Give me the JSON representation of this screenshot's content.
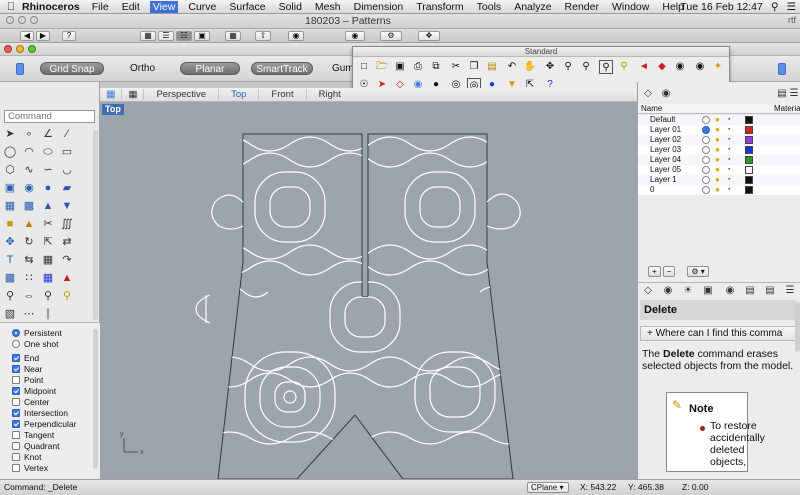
{
  "menubar": {
    "app": "Rhinoceros",
    "items": [
      "File",
      "Edit",
      "View",
      "Curve",
      "Surface",
      "Solid",
      "Mesh",
      "Dimension",
      "Transform",
      "Tools",
      "Analyze",
      "Render",
      "Window",
      "Help"
    ],
    "active_item": "View",
    "clock": "Tue 16 Feb  12:47"
  },
  "back_window": {
    "title": "180203 – Patterns",
    "right_text": "rtf"
  },
  "statusbar": {
    "grid_snap": "Grid Snap",
    "ortho": "Ortho",
    "planar": "Planar",
    "smarttrack": "SmartTrack",
    "gumball": "Gumb"
  },
  "standard_toolbar": {
    "title": "Standard"
  },
  "view_tabs": [
    "Perspective",
    "Top",
    "Front",
    "Right"
  ],
  "active_view": "Top",
  "viewport_label": "Top",
  "command_input_placeholder": "Command",
  "osnap": {
    "persistent": "Persistent",
    "one_shot": "One shot",
    "items": [
      {
        "label": "End",
        "checked": true
      },
      {
        "label": "Near",
        "checked": true
      },
      {
        "label": "Point",
        "checked": false
      },
      {
        "label": "Midpoint",
        "checked": true
      },
      {
        "label": "Center",
        "checked": false
      },
      {
        "label": "Intersection",
        "checked": true
      },
      {
        "label": "Perpendicular",
        "checked": true
      },
      {
        "label": "Tangent",
        "checked": false
      },
      {
        "label": "Quadrant",
        "checked": false
      },
      {
        "label": "Knot",
        "checked": false
      },
      {
        "label": "Vertex",
        "checked": false
      }
    ]
  },
  "layers": {
    "col_name": "Name",
    "col_material": "Materia",
    "rows": [
      {
        "name": "Default",
        "current": false,
        "color": "#111111"
      },
      {
        "name": "Layer 01",
        "current": true,
        "color": "#e02020"
      },
      {
        "name": "Layer 02",
        "current": false,
        "color": "#9a3dd6"
      },
      {
        "name": "Layer 03",
        "current": false,
        "color": "#2030d8"
      },
      {
        "name": "Layer 04",
        "current": false,
        "color": "#2a9a2a"
      },
      {
        "name": "Layer 05",
        "current": false,
        "color": "#ffffff"
      },
      {
        "name": "Layer 1",
        "current": false,
        "color": "#111111"
      },
      {
        "name": "0",
        "current": false,
        "color": "#111111"
      }
    ]
  },
  "help": {
    "heading": "Delete",
    "link": "+ Where can I find this comma",
    "body_prefix": "The ",
    "body_bold": "Delete",
    "body_rest": " command erases selected objects from the model.",
    "note_title": "Note",
    "note_text": "To restore accidentally deleted objects,"
  },
  "bottom": {
    "command": "Command: _Delete",
    "cplane": "CPlane",
    "x": "X: 543.22",
    "y": "Y: 465.38",
    "z": "Z: 0.00"
  },
  "colors": {
    "viewport_bg": "#9ea4ad",
    "accent": "#3d79e0",
    "curve": "#ffffff",
    "outline": "#333a44"
  }
}
